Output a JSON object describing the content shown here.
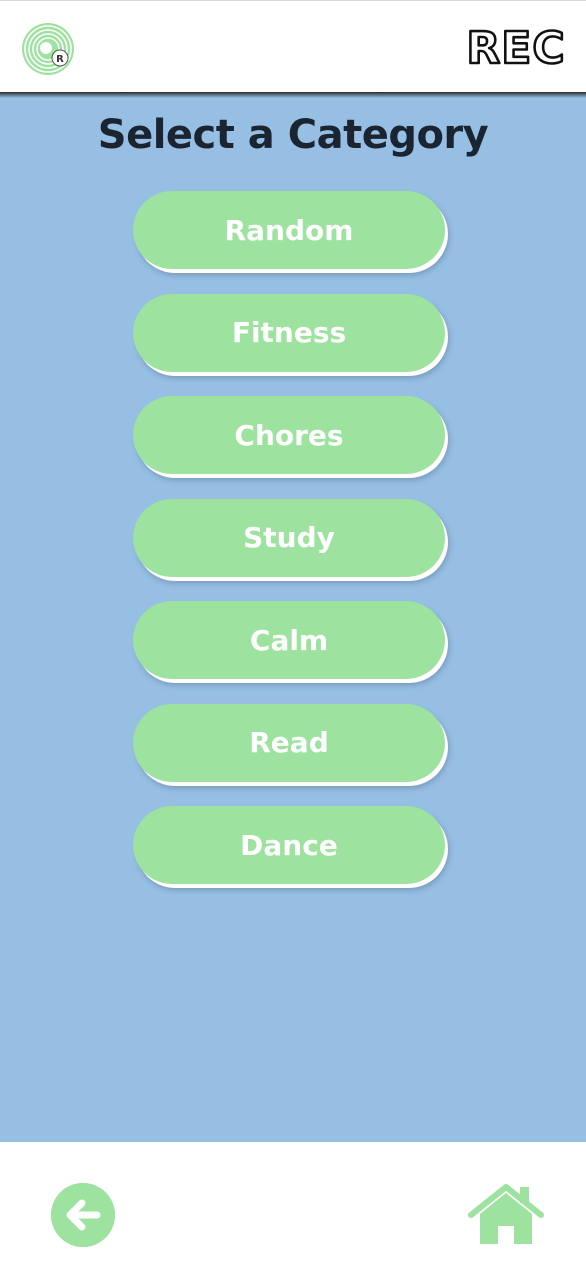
{
  "header": {
    "brand_text": "REC",
    "logo_badge": "R",
    "logo_icon": "vinyl-record-icon"
  },
  "main": {
    "title": "Select a Category",
    "categories": [
      {
        "label": "Random"
      },
      {
        "label": "Fitness"
      },
      {
        "label": "Chores"
      },
      {
        "label": "Study"
      },
      {
        "label": "Calm"
      },
      {
        "label": "Read"
      },
      {
        "label": "Dance"
      }
    ]
  },
  "footer": {
    "back_icon": "arrow-left-icon",
    "home_icon": "home-icon"
  },
  "colors": {
    "accent_green": "#9de29f",
    "background_blue": "#96bfe3",
    "title_text": "#1b2531",
    "button_text": "#ffffff"
  }
}
